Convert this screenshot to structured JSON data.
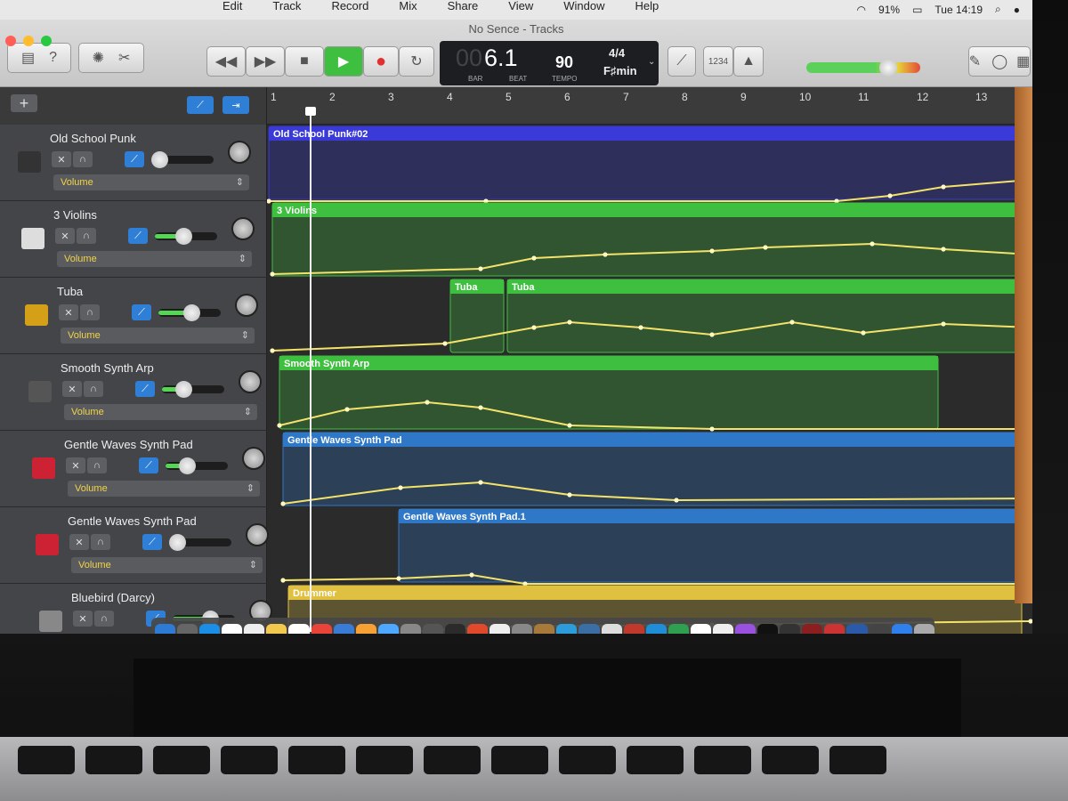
{
  "menubar": {
    "menus": [
      "Edit",
      "Track",
      "Record",
      "Mix",
      "Share",
      "View",
      "Window",
      "Help"
    ],
    "battery": "91%",
    "time": "Tue 14:19"
  },
  "window": {
    "title": "No Sence - Tracks"
  },
  "lcd": {
    "bar_beat": "6.1",
    "prefix": "00",
    "bar_label": "BAR",
    "beat_label": "BEAT",
    "tempo": "90",
    "tempo_label": "TEMPO",
    "time_sig": "4/4",
    "key": "F♯min",
    "count_in": "1234"
  },
  "ruler": {
    "bars": [
      "1",
      "2",
      "3",
      "4",
      "5",
      "6",
      "7",
      "8",
      "9",
      "10",
      "11",
      "12",
      "13"
    ]
  },
  "tracks": [
    {
      "name": "Old School Punk",
      "selector": "Volume",
      "region": "Old School Punk#02",
      "color": "#3a3ad8",
      "level": 0.0
    },
    {
      "name": "3 Violins",
      "selector": "Volume",
      "region": "3 Violins",
      "color": "#3fbf3f",
      "level": 0.45
    },
    {
      "name": "Tuba",
      "selector": "Volume",
      "region": "Tuba",
      "region2": "Tuba",
      "color": "#3fbf3f",
      "level": 0.55
    },
    {
      "name": "Smooth Synth Arp",
      "selector": "Volume",
      "region": "Smooth Synth Arp",
      "color": "#3fbf3f",
      "level": 0.3
    },
    {
      "name": "Gentle Waves Synth Pad",
      "selector": "Volume",
      "region": "Gentle Waves Synth Pad",
      "color": "#2f78c8",
      "level": 0.3
    },
    {
      "name": "Gentle Waves Synth Pad",
      "selector": "Volume",
      "region": "Gentle Waves Synth Pad.1",
      "color": "#2f78c8",
      "level": 0.0
    },
    {
      "name": "Bluebird (Darcy)",
      "selector": "",
      "region": "Drummer",
      "color": "#e0c040",
      "level": 0.65
    }
  ],
  "colors": {
    "accent": "#2f7fd6",
    "playButton": "#3fbf3f",
    "record": "#e03030"
  }
}
